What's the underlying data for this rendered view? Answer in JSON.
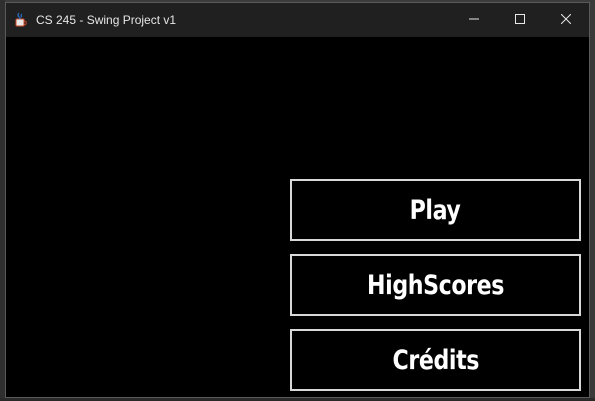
{
  "window": {
    "title": "CS 245 - Swing Project v1",
    "icon": "java-coffee-icon",
    "controls": [
      "minimize-icon",
      "maximize-icon",
      "close-icon"
    ]
  },
  "menu": {
    "play_label": "Play",
    "highscores_label": "HighScores",
    "credits_label": "Crédits"
  },
  "colors": {
    "titlebar": "#202020",
    "background": "#000000",
    "button_border": "#d8d8d8",
    "button_text": "#ffffff"
  }
}
